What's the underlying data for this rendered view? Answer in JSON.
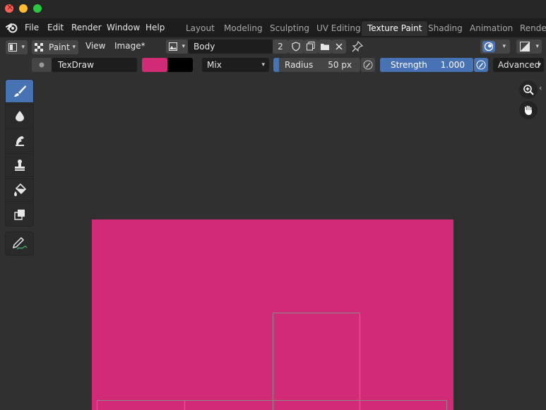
{
  "menubar": {
    "items": [
      "File",
      "Edit",
      "Render",
      "Window",
      "Help"
    ]
  },
  "workspaces": [
    "Layout",
    "Modeling",
    "Sculpting",
    "UV Editing",
    "Texture Paint",
    "Shading",
    "Animation",
    "Renderi"
  ],
  "active_workspace": "Texture Paint",
  "header": {
    "mode": "Paint",
    "view": "View",
    "image_menu": "Image*",
    "image_name": "Body",
    "users_count": "2"
  },
  "tool_settings": {
    "brush_name": "TexDraw",
    "blend_mode": "Mix",
    "radius_label": "Radius",
    "radius_value": "50 px",
    "radius_fraction": 0.0,
    "strength_label": "Strength",
    "strength_value": "1.000",
    "strength_fraction": 1.0,
    "advanced": "Advanced",
    "primary_color": "#d22a77",
    "secondary_color": "#000000"
  },
  "tools": [
    "brush-draw-icon",
    "soften-icon",
    "smear-icon",
    "clone-icon",
    "fill-icon",
    "mask-icon",
    "annotate-icon"
  ],
  "canvas": {
    "texture_color": "#d22a77"
  },
  "colors": {
    "accent": "#4772b3",
    "header_bg": "#303030",
    "menubar_bg": "#1d1d1d"
  }
}
